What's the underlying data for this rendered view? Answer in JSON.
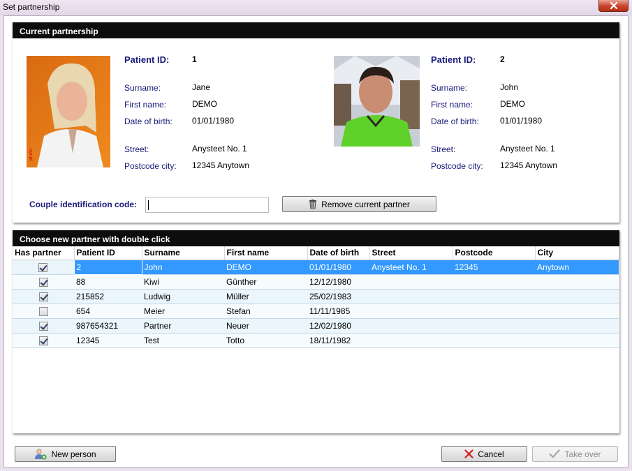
{
  "window": {
    "title": "Set partnership"
  },
  "current": {
    "header": "Current partnership",
    "labels": {
      "patient_id": "Patient ID:",
      "surname": "Surname:",
      "first_name": "First name:",
      "date_of_birth": "Date of birth:",
      "street": "Street:",
      "postcode_city": "Postcode city:"
    },
    "partner_a": {
      "patient_id": "1",
      "surname": "Jane",
      "first_name": "DEMO",
      "date_of_birth": "01/01/1980",
      "street": "Anysteet No. 1",
      "postcode_city": "12345 Anytown"
    },
    "partner_b": {
      "patient_id": "2",
      "surname": "John",
      "first_name": "DEMO",
      "date_of_birth": "01/01/1980",
      "street": "Anysteet No. 1",
      "postcode_city": "12345 Anytown"
    },
    "couple_code_label": "Couple identification code:",
    "couple_code_value": "",
    "remove_button": "Remove current partner"
  },
  "chooser": {
    "header": "Choose new partner with double click",
    "columns": [
      "Has partner",
      "Patient ID",
      "Surname",
      "First name",
      "Date of birth",
      "Street",
      "Postcode",
      "City"
    ],
    "rows": [
      {
        "has_partner": true,
        "patient_id": "2",
        "surname": "John",
        "first_name": "DEMO",
        "dob": "01/01/1980",
        "street": "Anysteet No. 1",
        "postcode": "12345",
        "city": "Anytown",
        "selected": true
      },
      {
        "has_partner": true,
        "patient_id": "88",
        "surname": "Kiwi",
        "first_name": "Günther",
        "dob": "12/12/1980",
        "street": "",
        "postcode": "",
        "city": ""
      },
      {
        "has_partner": true,
        "patient_id": "215852",
        "surname": "Ludwig",
        "first_name": "Müller",
        "dob": "25/02/1983",
        "street": "",
        "postcode": "",
        "city": ""
      },
      {
        "has_partner": false,
        "patient_id": "654",
        "surname": "Meier",
        "first_name": "Stefan",
        "dob": "11/11/1985",
        "street": "",
        "postcode": "",
        "city": ""
      },
      {
        "has_partner": true,
        "patient_id": "987654321",
        "surname": "Partner",
        "first_name": "Neuer",
        "dob": "12/02/1980",
        "street": "",
        "postcode": "",
        "city": ""
      },
      {
        "has_partner": true,
        "patient_id": "12345",
        "surname": "Test",
        "first_name": "Totto",
        "dob": "18/11/1982",
        "street": "",
        "postcode": "",
        "city": ""
      }
    ]
  },
  "footer": {
    "new_person": "New person",
    "cancel": "Cancel",
    "take_over": "Take over"
  },
  "icons": {
    "close": "close-icon",
    "trash": "trash-icon",
    "new_person": "add-person-icon",
    "cancel": "x-icon",
    "take_over": "checkmark-icon"
  },
  "colors": {
    "header_bg": "#0d0d0d",
    "label_text": "#1a1a7a",
    "selection": "#3399ff",
    "row_tint": "#eaf5fc"
  }
}
